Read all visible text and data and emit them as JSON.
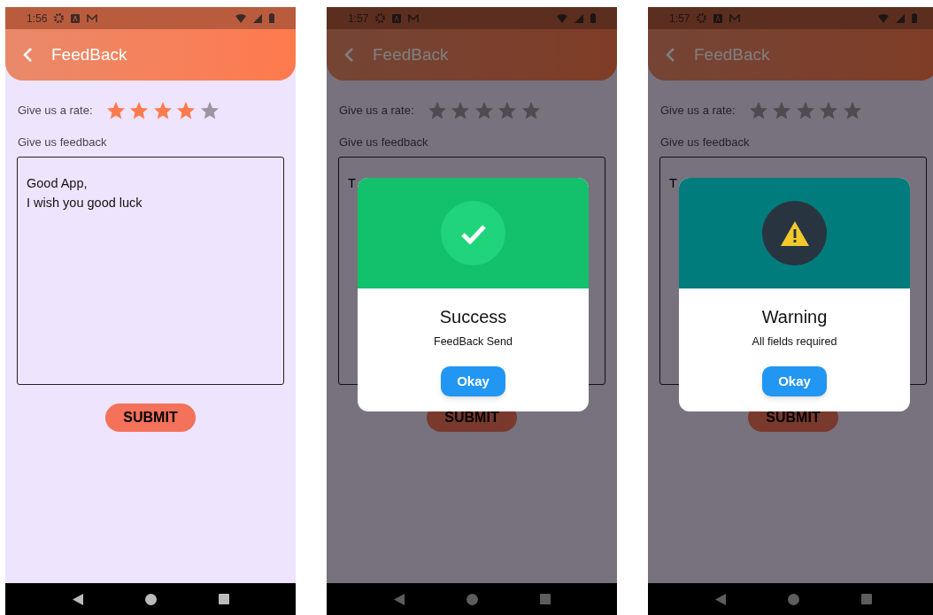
{
  "screens": [
    {
      "status_time": "1:56",
      "title": "FeedBack",
      "rate_label": "Give us a rate:",
      "stars": 4,
      "feedback_label": "Give us feedback",
      "field": {
        "value": "Good App,\nI wish you good luck"
      },
      "submit": "SUBMIT"
    },
    {
      "status_time": "1:57",
      "title": "FeedBack",
      "rate_label": "Give us a rate:",
      "stars": 0,
      "feedback_label": "Give us feedback",
      "field": {
        "placeholder": "T"
      },
      "submit": "SUBMIT",
      "dialog": {
        "kind": "success",
        "title": "Success",
        "message": "FeedBack Send",
        "button": "Okay"
      }
    },
    {
      "status_time": "1:57",
      "title": "FeedBack",
      "rate_label": "Give us a rate:",
      "stars": 0,
      "feedback_label": "Give us feedback",
      "field": {
        "placeholder": "T"
      },
      "submit": "SUBMIT",
      "dialog": {
        "kind": "warning",
        "title": "Warning",
        "message": "All fields required",
        "button": "Okay"
      }
    }
  ]
}
